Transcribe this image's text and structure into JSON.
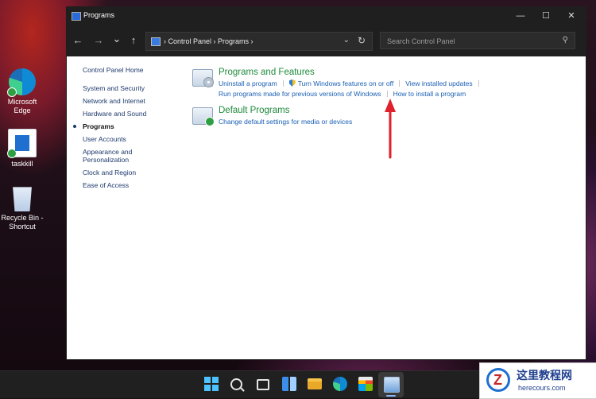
{
  "desktop": {
    "icons": [
      {
        "label": "Microsoft\nEdge"
      },
      {
        "label": "taskkill"
      },
      {
        "label": "Recycle Bin -\nShortcut"
      }
    ]
  },
  "window": {
    "title": "Programs",
    "controls": {
      "minimize": "—",
      "maximize": "☐",
      "close": "✕"
    },
    "nav": {
      "back": "←",
      "forward": "→",
      "recent": "⌄",
      "up": "↑"
    },
    "breadcrumb": "›  Control Panel  ›  Programs  ›",
    "search_placeholder": "Search Control Panel"
  },
  "sidebar": {
    "home": "Control Panel Home",
    "items": [
      {
        "label": "System and Security"
      },
      {
        "label": "Network and Internet"
      },
      {
        "label": "Hardware and Sound"
      },
      {
        "label": "Programs",
        "active": true
      },
      {
        "label": "User Accounts"
      },
      {
        "label": "Appearance and\nPersonalization"
      },
      {
        "label": "Clock and Region"
      },
      {
        "label": "Ease of Access"
      }
    ]
  },
  "categories": {
    "programs_features": {
      "title": "Programs and Features",
      "link1": "Uninstall a program",
      "link2": "Turn Windows features on or off",
      "link3": "View installed updates",
      "link4": "Run programs made for previous versions of Windows",
      "link5": "How to install a program"
    },
    "default_programs": {
      "title": "Default Programs",
      "link1": "Change default settings for media or devices"
    }
  },
  "annotation": {
    "color": "#e0202a"
  },
  "watermark": {
    "brand": "这里教程网",
    "url": "herecours.com"
  }
}
